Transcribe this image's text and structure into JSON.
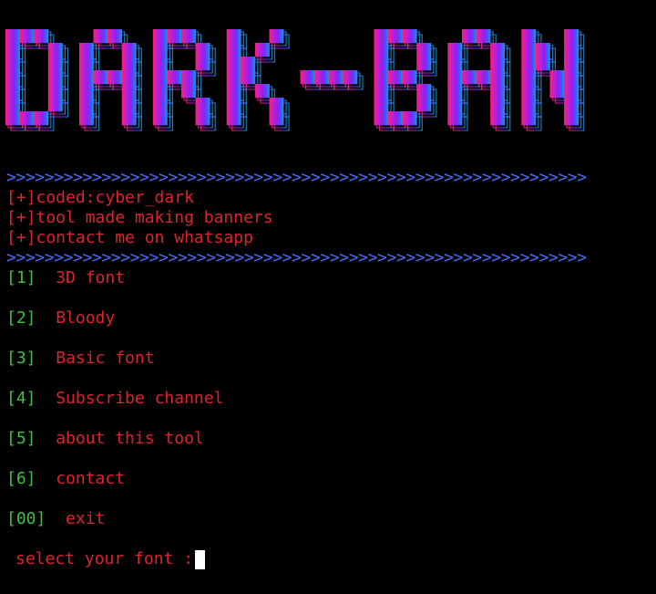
{
  "banner": {
    "text": "DARK-BAN",
    "gradient": [
      "#ff1f6e",
      "#c21fd6",
      "#8c22f0",
      "#3c5cff",
      "#1a9cdc"
    ]
  },
  "arrows": ">>>>>>>>>>>>>>>>>>>>>>>>>>>>>>>>>>>>>>>>>>>>>>>>>>>>>>>>>>>>>",
  "info": [
    "[+]coded:cyber_dark",
    "[+]tool made making banners",
    "[+]contact me on whatsapp"
  ],
  "menu": [
    {
      "num": "[1]",
      "label": "3D font"
    },
    {
      "num": "[2]",
      "label": "Bloody"
    },
    {
      "num": "[3]",
      "label": "Basic font"
    },
    {
      "num": "[4]",
      "label": "Subscribe channel"
    },
    {
      "num": "[5]",
      "label": "about this tool"
    },
    {
      "num": "[6]",
      "label": "contact"
    },
    {
      "num": "[00]",
      "label": "exit"
    }
  ],
  "prompt": "select your font :",
  "colors": {
    "arrows": "#4b6bf0",
    "info": "#e0232a",
    "number": "#3fbf3f",
    "label": "#e0232a",
    "cursor": "#ffffff"
  }
}
